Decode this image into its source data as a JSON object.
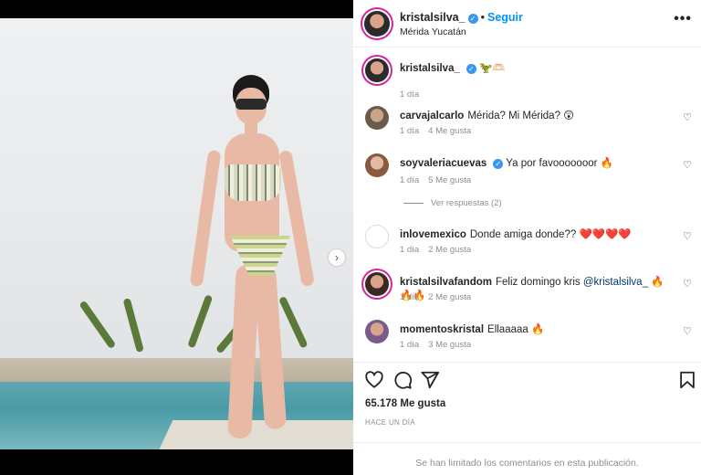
{
  "post": {
    "username": "kristalsilva_",
    "follow_label": "Seguir",
    "separator": "•",
    "location": "Mérida Yucatán",
    "more_label": "•••"
  },
  "caption": {
    "username": "kristalsilva_",
    "text": "🦖🫶🏻",
    "time": "1 día"
  },
  "comments": [
    {
      "username": "carvajalcarlo",
      "text": "Mérida? Mi Mérida? 😲",
      "time": "1 día",
      "likes": "4 Me gusta",
      "avatar_color": "#6b5b4a"
    },
    {
      "username": "soyvaleriacuevas",
      "verified": true,
      "text": "Ya por favooooooor 🔥",
      "time": "1 día",
      "likes": "5 Me gusta",
      "avatar_color": "#c8a08a"
    },
    {
      "username": "inlovemexico",
      "text": "Donde amiga donde?? ❤️❤️❤️❤️",
      "time": "1 día",
      "likes": "2 Me gusta",
      "avatar_color": "#ffffff"
    },
    {
      "username": "kristalsilvafandom",
      "text_before": "Feliz domingo kris ",
      "mention": "@kristalsilva_",
      "text_after": " 🔥🔥🔥",
      "time": "1 día",
      "likes": "2 Me gusta",
      "avatar_color": "#9a6b55"
    },
    {
      "username": "momentoskristal",
      "text": "Ellaaaaa 🔥",
      "time": "1 día",
      "likes": "3 Me gusta",
      "avatar_color": "#7a5b8a"
    }
  ],
  "view_replies": "Ver respuestas (2)",
  "likes_count": "65.178 Me gusta",
  "post_date": "HACE UN DÍA",
  "comments_limited": "Se han limitado los comentarios en esta publicación.",
  "icons": {
    "like": "heart-icon",
    "comment": "comment-icon",
    "share": "share-icon",
    "save": "bookmark-icon",
    "next": "chevron-right-icon"
  },
  "colors": {
    "accent": "#0095f6",
    "verified": "#3897f0",
    "muted": "#8e8e8e"
  }
}
